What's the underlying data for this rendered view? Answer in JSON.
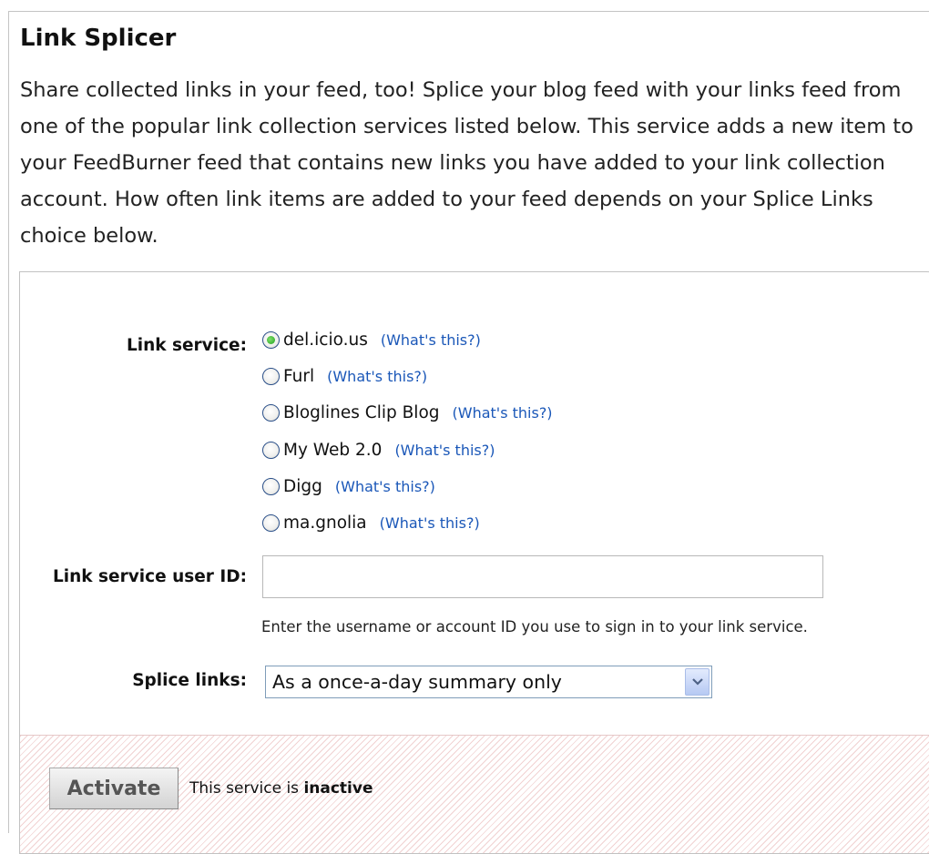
{
  "title": "Link Splicer",
  "description": "Share collected links in your feed, too! Splice your blog feed with your links feed from one of the popular link collection services listed below. This service adds a new item to your FeedBurner feed that contains new links you have added to your link collection account. How often link items are added to your feed depends on your Splice Links choice below.",
  "form": {
    "link_service_label": "Link service:",
    "services": [
      {
        "label": "del.icio.us",
        "help": "(What's this?)",
        "selected": true
      },
      {
        "label": "Furl",
        "help": "(What's this?)",
        "selected": false
      },
      {
        "label": "Bloglines Clip Blog",
        "help": "(What's this?)",
        "selected": false
      },
      {
        "label": "My Web 2.0",
        "help": "(What's this?)",
        "selected": false
      },
      {
        "label": "Digg",
        "help": "(What's this?)",
        "selected": false
      },
      {
        "label": "ma.gnolia",
        "help": "(What's this?)",
        "selected": false
      }
    ],
    "user_id_label": "Link service user ID:",
    "user_id_value": "",
    "user_id_hint": "Enter the username or account ID you use to sign in to your link service.",
    "splice_label": "Splice links:",
    "splice_value": "As a once-a-day summary only"
  },
  "footer": {
    "activate_label": "Activate",
    "status_prefix": "This service is ",
    "status_value": "inactive"
  },
  "colors": {
    "link": "#1a57b8",
    "footer_stripe": "#f1d2d2",
    "radio_selected": "#21a121"
  }
}
